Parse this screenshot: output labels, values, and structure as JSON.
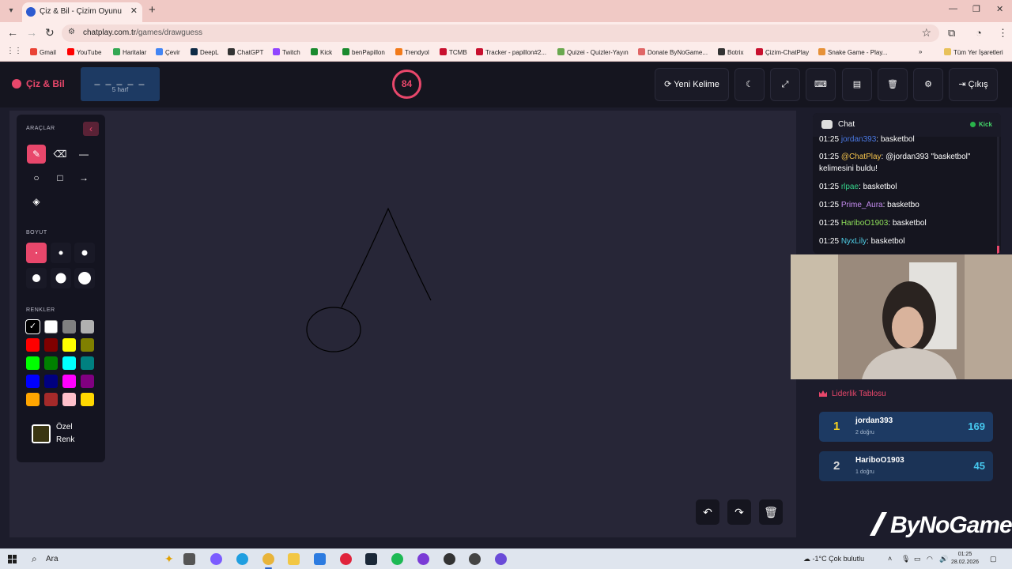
{
  "browser": {
    "tab_title": "Çiz & Bil - Çizim Oyunu",
    "url_host": "chatplay.com.tr",
    "url_path": "/games/drawguess",
    "bookmarks": [
      "Gmail",
      "YouTube",
      "Haritalar",
      "Çevir",
      "DeepL",
      "ChatGPT",
      "Twitch",
      "Kick",
      "benPapillon",
      "Trendyol",
      "TCMB",
      "Tracker - papillon#2...",
      "Quizei - Quizler-Yayın",
      "Donate ByNoGame...",
      "Botrix",
      "Çizim-ChatPlay",
      "Snake Game - Play..."
    ],
    "all_bookmarks": "Tüm Yer İşaretleri"
  },
  "header": {
    "brand": "Çiz & Bil",
    "word_mask": "_ _ _ _ _",
    "word_hint": "5 harf",
    "timer": "84",
    "new_word": "Yeni Kelime",
    "exit": "Çıkış"
  },
  "tools": {
    "title": "ARAÇLAR",
    "size_title": "BOYUT",
    "colors_title": "RENKLER",
    "custom_label_1": "Özel",
    "custom_label_2": "Renk",
    "colors": [
      "#000000",
      "#ffffff",
      "#808080",
      "#b0b0b0",
      "#ff0000",
      "#800000",
      "#ffff00",
      "#808000",
      "#00ff00",
      "#008000",
      "#00ffff",
      "#008080",
      "#0000ff",
      "#000080",
      "#ff00ff",
      "#800080",
      "#ffa500",
      "#a52a2a",
      "#ffc0cb",
      "#ffd700"
    ],
    "custom_color": "#3a3512"
  },
  "chat": {
    "title": "Chat",
    "platform": "Kick",
    "messages": [
      {
        "time": "01:25",
        "user": "jordan393",
        "sep": ":",
        "text": " basketbol",
        "color": "#4c7be8"
      },
      {
        "time": "01:25",
        "user": "@ChatPlay",
        "sep": ":",
        "text": " @jordan393 \"basketbol\" kelimesini buldu!",
        "color": "#f2c14b"
      },
      {
        "time": "01:25",
        "user": "rlpae",
        "sep": ":",
        "text": " basketbol",
        "color": "#35d18a"
      },
      {
        "time": "01:25",
        "user": "Prime_Aura",
        "sep": ":",
        "text": " basketbo",
        "color": "#c58cf0"
      },
      {
        "time": "01:25",
        "user": "HariboO1903",
        "sep": ":",
        "text": " basketbol",
        "color": "#8fe05a"
      },
      {
        "time": "01:25",
        "user": "NyxLily",
        "sep": ":",
        "text": " basketbol",
        "color": "#4fd0e8"
      }
    ]
  },
  "leaderboard": {
    "title": "Liderlik Tablosu",
    "rows": [
      {
        "rank": "1",
        "name": "jordan393",
        "sub": "2 doğru",
        "score": "169",
        "rank_color": "#f5d020",
        "score_color": "#46c8ef"
      },
      {
        "rank": "2",
        "name": "HariboO1903",
        "sub": "1 doğru",
        "score": "45",
        "rank_color": "#d8d8d8",
        "score_color": "#46c8ef"
      }
    ]
  },
  "watermark": "ByNoGame",
  "taskbar": {
    "search": "Ara",
    "weather": "-1°C  Çok bulutlu",
    "time": "01:25",
    "date": "28.02.2026"
  }
}
